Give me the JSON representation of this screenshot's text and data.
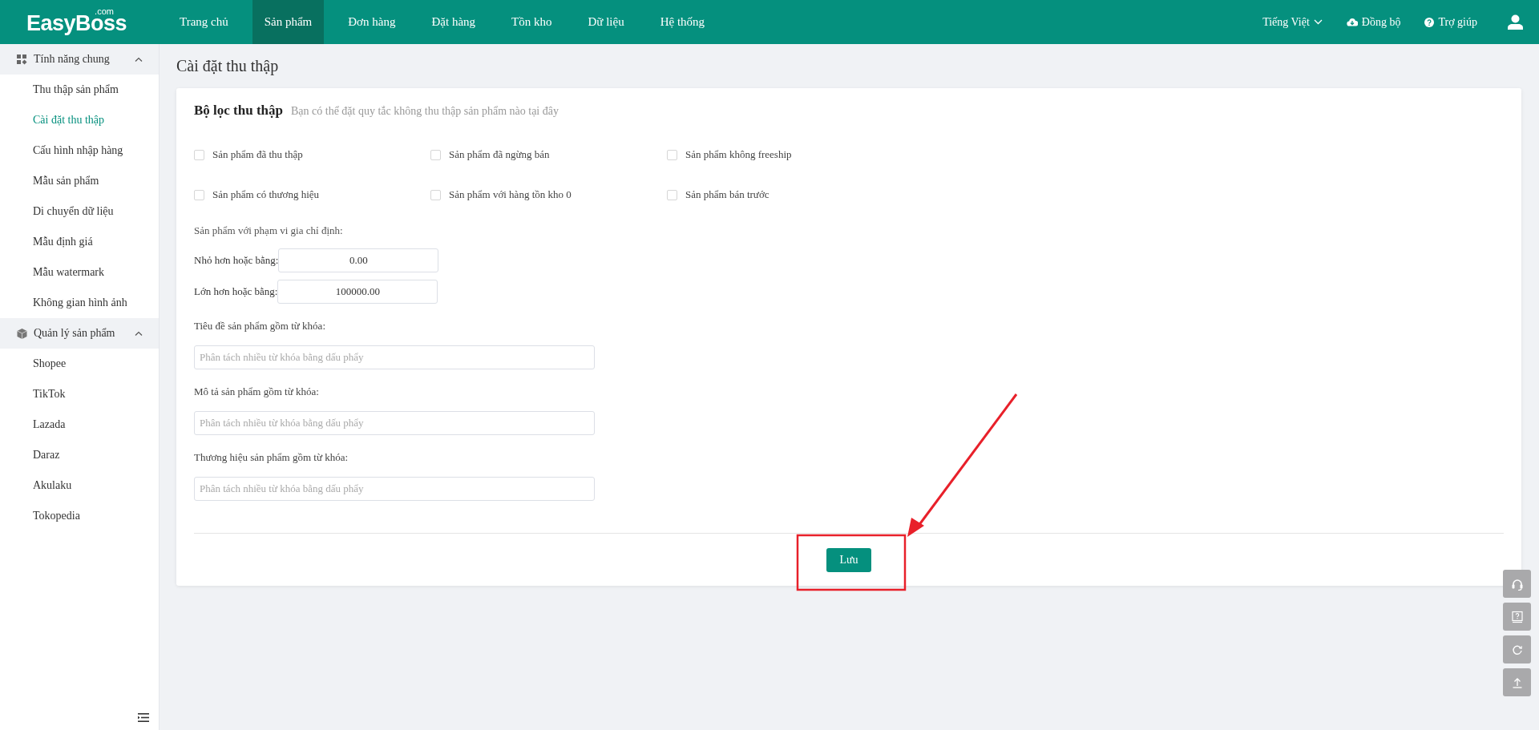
{
  "header": {
    "logo": "EasyBoss",
    "logo_suffix": ".com",
    "nav": [
      {
        "label": "Trang chủ",
        "selected": false
      },
      {
        "label": "Sản phẩm",
        "selected": true
      },
      {
        "label": "Đơn hàng",
        "selected": false
      },
      {
        "label": "Đặt hàng",
        "selected": false
      },
      {
        "label": "Tồn kho",
        "selected": false
      },
      {
        "label": "Dữ liệu",
        "selected": false
      },
      {
        "label": "Hệ thống",
        "selected": false
      }
    ],
    "language": "Tiếng Việt",
    "sync": "Đồng bộ",
    "help": "Trợ giúp"
  },
  "sidebar": {
    "groups": [
      {
        "title": "Tính năng chung",
        "expanded": true,
        "items": [
          {
            "label": "Thu thập sản phẩm",
            "selected": false
          },
          {
            "label": "Cài đặt thu thập",
            "selected": true
          },
          {
            "label": "Cấu hình nhập hàng",
            "selected": false
          },
          {
            "label": "Mẫu sản phẩm",
            "selected": false
          },
          {
            "label": "Di chuyển dữ liệu",
            "selected": false
          },
          {
            "label": "Mẫu định giá",
            "selected": false
          },
          {
            "label": "Mẫu watermark",
            "selected": false
          },
          {
            "label": "Không gian hình ảnh",
            "selected": false
          }
        ]
      },
      {
        "title": "Quản lý sản phẩm",
        "expanded": true,
        "items": [
          {
            "label": "Shopee",
            "selected": false
          },
          {
            "label": "TikTok",
            "selected": false
          },
          {
            "label": "Lazada",
            "selected": false
          },
          {
            "label": "Daraz",
            "selected": false
          },
          {
            "label": "Akulaku",
            "selected": false
          },
          {
            "label": "Tokopedia",
            "selected": false
          }
        ]
      }
    ]
  },
  "page_title": "Cài đặt thu thập",
  "filter": {
    "title": "Bộ lọc thu thập",
    "subtitle": "Bạn có thể đặt quy tắc không thu thập sản phẩm nào tại đây",
    "checkboxes": [
      {
        "label": "Sản phẩm đã thu thập",
        "checked": false
      },
      {
        "label": "Sản phẩm đã ngừng bán",
        "checked": false
      },
      {
        "label": "Sản phẩm không freeship",
        "checked": false
      },
      {
        "label": "Sản phẩm có thương hiệu",
        "checked": false
      },
      {
        "label": "Sản phẩm với hàng tồn kho 0",
        "checked": false
      },
      {
        "label": "Sản phẩm bán trước",
        "checked": false
      }
    ],
    "price_range": {
      "label": "Sản phẩm với phạm vi gia chỉ định:",
      "fields": [
        {
          "label": "Nhỏ hơn hoặc bằng:",
          "value": "0.00"
        },
        {
          "label": "Lớn hơn hoặc bằng:",
          "value": "100000.00"
        }
      ]
    },
    "keyword_fields": [
      {
        "label": "Tiêu đề sản phẩm gồm từ khóa:",
        "placeholder": "Phân tách nhiều từ khóa bằng dấu phẩy"
      },
      {
        "label": "Mô tả sản phẩm gồm từ khóa:",
        "placeholder": "Phân tách nhiều từ khóa bằng dấu phẩy"
      },
      {
        "label": "Thương hiệu sản phẩm gồm từ khóa:",
        "placeholder": "Phân tách nhiều từ khóa bằng dấu phẩy"
      }
    ],
    "save_button": "Lưu"
  }
}
